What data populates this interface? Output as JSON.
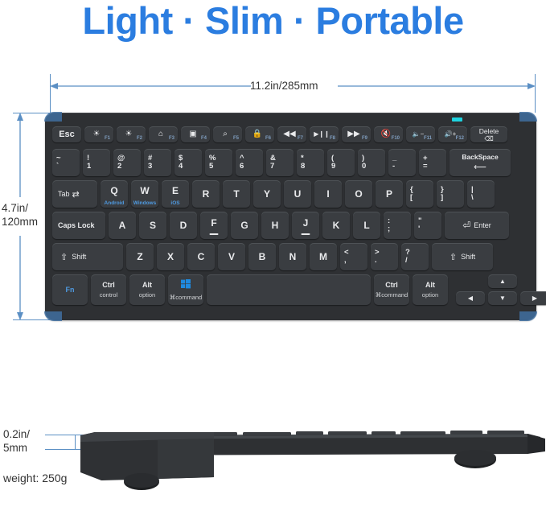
{
  "headline": "Light · Slim · Portable",
  "colors": {
    "headline_blue": "#2b7de0",
    "dimension_blue": "#5b8fc4",
    "keyboard_body": "#2e3033",
    "key_face": "#3a3d41",
    "os_label_blue": "#4f9ae0",
    "led_cyan": "#1fd3e0"
  },
  "dimensions": {
    "width_label": "11.2in/285mm",
    "height_label_line1": "4.7in/",
    "height_label_line2": "120mm",
    "thickness_label_line1": "0.2in/",
    "thickness_label_line2": "5mm",
    "weight_label": "weight: 250g"
  },
  "keyboard": {
    "led_indicator": "status-led",
    "function_row": [
      {
        "main": "Esc",
        "type": "text"
      },
      {
        "glyph": "☀",
        "fn": "F1",
        "icon": "brightness-down-icon"
      },
      {
        "glyph": "☀",
        "fn": "F2",
        "icon": "brightness-up-icon"
      },
      {
        "glyph": "⌂",
        "fn": "F3",
        "icon": "home-icon"
      },
      {
        "glyph": "▣",
        "fn": "F4",
        "icon": "app-switcher-icon"
      },
      {
        "glyph": "⌕",
        "fn": "F5",
        "icon": "search-icon"
      },
      {
        "glyph": "🔒",
        "fn": "F6",
        "icon": "lock-icon"
      },
      {
        "glyph": "◀◀",
        "fn": "F7",
        "icon": "rewind-icon"
      },
      {
        "glyph": "▶❙❙",
        "fn": "F8",
        "icon": "play-pause-icon"
      },
      {
        "glyph": "▶▶",
        "fn": "F9",
        "icon": "fast-forward-icon"
      },
      {
        "glyph": "🔇",
        "fn": "F10",
        "icon": "mute-icon"
      },
      {
        "glyph": "🔈−",
        "fn": "F11",
        "icon": "volume-down-icon"
      },
      {
        "glyph": "🔊+",
        "fn": "F12",
        "icon": "volume-up-icon"
      },
      {
        "main": "Delete",
        "type": "text",
        "icon": "delete-icon"
      }
    ],
    "number_row": [
      {
        "top": "~",
        "bot": "`"
      },
      {
        "top": "!",
        "bot": "1"
      },
      {
        "top": "@",
        "bot": "2"
      },
      {
        "top": "#",
        "bot": "3"
      },
      {
        "top": "$",
        "bot": "4"
      },
      {
        "top": "%",
        "bot": "5"
      },
      {
        "top": "^",
        "bot": "6"
      },
      {
        "top": "&",
        "bot": "7"
      },
      {
        "top": "*",
        "bot": "8"
      },
      {
        "top": "(",
        "bot": "9"
      },
      {
        "top": ")",
        "bot": "0"
      },
      {
        "top": "_",
        "bot": "-"
      },
      {
        "top": "+",
        "bot": "="
      },
      {
        "main": "BackSpace",
        "icon": "backspace-icon"
      }
    ],
    "qwerty_row": [
      {
        "main": "Tab",
        "icon": "tab-icon"
      },
      {
        "main": "Q",
        "os": "Android"
      },
      {
        "main": "W",
        "os": "Windows"
      },
      {
        "main": "E",
        "os": "iOS"
      },
      {
        "main": "R"
      },
      {
        "main": "T"
      },
      {
        "main": "Y"
      },
      {
        "main": "U"
      },
      {
        "main": "I"
      },
      {
        "main": "O"
      },
      {
        "main": "P"
      },
      {
        "top": "{",
        "bot": "["
      },
      {
        "top": "}",
        "bot": "]"
      },
      {
        "top": "|",
        "bot": "\\"
      }
    ],
    "home_row": [
      {
        "main": "Caps Lock"
      },
      {
        "main": "A"
      },
      {
        "main": "S"
      },
      {
        "main": "D"
      },
      {
        "main": "F",
        "homing": true
      },
      {
        "main": "G"
      },
      {
        "main": "H"
      },
      {
        "main": "J",
        "homing": true
      },
      {
        "main": "K"
      },
      {
        "main": "L"
      },
      {
        "top": ":",
        "bot": ";"
      },
      {
        "top": "\"",
        "bot": "'"
      },
      {
        "main": "Enter",
        "icon": "enter-icon"
      }
    ],
    "shift_row": [
      {
        "main": "Shift",
        "icon": "shift-icon"
      },
      {
        "main": "Z"
      },
      {
        "main": "X"
      },
      {
        "main": "C"
      },
      {
        "main": "V"
      },
      {
        "main": "B"
      },
      {
        "main": "N"
      },
      {
        "main": "M"
      },
      {
        "top": "<",
        "bot": ","
      },
      {
        "top": ">",
        "bot": "."
      },
      {
        "top": "?",
        "bot": "/"
      },
      {
        "main": "Shift",
        "icon": "shift-icon"
      }
    ],
    "bottom_row": {
      "fn": "Fn",
      "ctrl_left_top": "Ctrl",
      "ctrl_left_bot": "control",
      "alt_left_top": "Alt",
      "alt_left_bot": "option",
      "cmd_left_bot": "⌘command",
      "cmd_left_icon": "windows-logo-icon",
      "space": "",
      "ctrl_right_top": "Ctrl",
      "ctrl_right_bot": "⌘command",
      "alt_right_top": "Alt",
      "alt_right_bot": "option",
      "arrow_left": "◀",
      "arrow_up": "▲",
      "arrow_down": "▼",
      "arrow_right": "▶"
    }
  }
}
